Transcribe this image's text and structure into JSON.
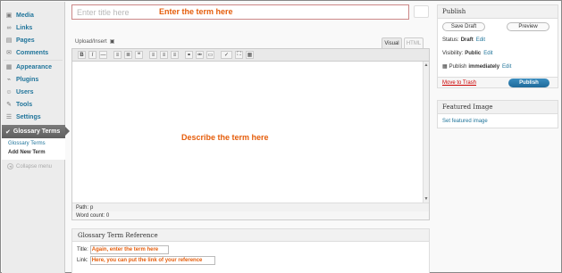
{
  "sidebar": {
    "items": [
      {
        "label": "Media",
        "icon": "media-icon",
        "glyph": "▣"
      },
      {
        "label": "Links",
        "icon": "links-icon",
        "glyph": "∞"
      },
      {
        "label": "Pages",
        "icon": "pages-icon",
        "glyph": "▤"
      },
      {
        "label": "Comments",
        "icon": "comments-icon",
        "glyph": "✉"
      },
      {
        "label": "Appearance",
        "icon": "appearance-icon",
        "glyph": "▦"
      },
      {
        "label": "Plugins",
        "icon": "plugins-icon",
        "glyph": "⌁"
      },
      {
        "label": "Users",
        "icon": "users-icon",
        "glyph": "☺"
      },
      {
        "label": "Tools",
        "icon": "tools-icon",
        "glyph": "✎"
      },
      {
        "label": "Settings",
        "icon": "settings-icon",
        "glyph": "☰"
      }
    ],
    "active": {
      "label": "Glossary Terms",
      "icon": "glossary-icon",
      "glyph": "✔"
    },
    "submenu": [
      {
        "label": "Glossary Terms"
      },
      {
        "label": "Add New Term"
      }
    ],
    "collapse_label": "Collapse menu"
  },
  "title_input": {
    "placeholder": "Enter title here",
    "annotation": "Enter the term here"
  },
  "editor": {
    "upload_label": "Upload/Insert",
    "tabs": {
      "visual": "Visual",
      "html": "HTML"
    },
    "toolbar": [
      {
        "glyph": "B",
        "name": "bold-icon"
      },
      {
        "glyph": "I",
        "name": "italic-icon"
      },
      {
        "glyph": "—",
        "name": "strikethrough-icon"
      },
      {
        "glyph": "≡",
        "name": "bullet-list-icon"
      },
      {
        "glyph": "≣",
        "name": "numbered-list-icon"
      },
      {
        "glyph": "❝",
        "name": "blockquote-icon"
      },
      {
        "glyph": "≡",
        "name": "align-left-icon"
      },
      {
        "glyph": "≡",
        "name": "align-center-icon"
      },
      {
        "glyph": "≡",
        "name": "align-right-icon"
      },
      {
        "glyph": "⚭",
        "name": "link-icon"
      },
      {
        "glyph": "⚮",
        "name": "unlink-icon"
      },
      {
        "glyph": "▭",
        "name": "more-tag-icon"
      },
      {
        "glyph": "✓",
        "name": "spellcheck-icon"
      },
      {
        "glyph": "⛶",
        "name": "fullscreen-icon"
      },
      {
        "glyph": "▦",
        "name": "kitchen-sink-icon"
      }
    ],
    "content_annotation": "Describe the term here",
    "path_label": "Path:",
    "path_value": "p",
    "word_count": "Word count: 0"
  },
  "glossary_box": {
    "title": "Glossary Term Reference",
    "title_label": "Title:",
    "title_annotation": "Again, enter the term here",
    "link_label": "Link:",
    "link_annotation": "Here, you can put the link of your reference"
  },
  "publish": {
    "heading": "Publish",
    "save_draft": "Save Draft",
    "preview": "Preview",
    "status_label": "Status:",
    "status_value": "Draft",
    "visibility_label": "Visibility:",
    "visibility_value": "Public",
    "publish_label": "Publish",
    "publish_value": "immediately",
    "edit": "Edit",
    "move_to_trash": "Move to Trash",
    "publish_button": "Publish"
  },
  "featured_image": {
    "heading": "Featured Image",
    "link": "Set featured image"
  },
  "colors": {
    "annotation": "#e55d0b",
    "link": "#21759b",
    "publish_button": "#21759b",
    "trash": "#cc0000"
  }
}
